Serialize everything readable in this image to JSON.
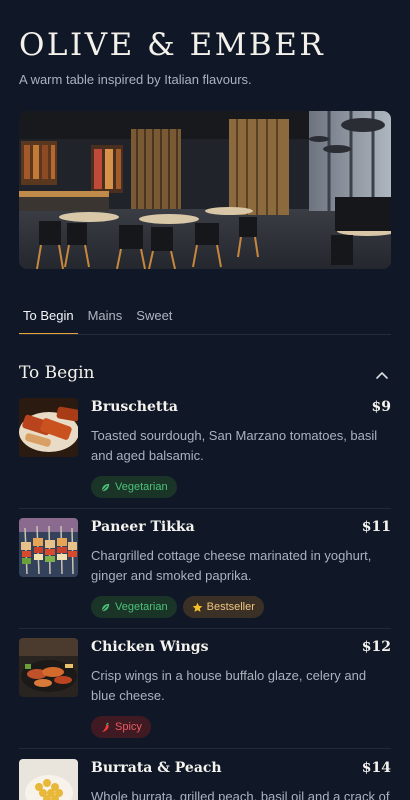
{
  "brand": {
    "name": "OLIVE & EMBER",
    "tagline": "A warm table inspired by Italian flavours."
  },
  "tabs": [
    {
      "label": "To Begin",
      "active": true
    },
    {
      "label": "Mains",
      "active": false
    },
    {
      "label": "Sweet",
      "active": false
    }
  ],
  "section": {
    "title": "To Begin",
    "toggle_icon": "chevron-up-icon"
  },
  "items": [
    {
      "name": "Bruschetta",
      "price": "$9",
      "description": "Toasted sourdough, San Marzano tomatoes, basil and aged balsamic.",
      "badges": [
        {
          "label": "Vegetarian",
          "icon": "leaf-icon",
          "kind": "veg"
        }
      ]
    },
    {
      "name": "Paneer Tikka",
      "price": "$11",
      "description": "Chargrilled cottage cheese marinated in yoghurt, ginger and smoked paprika.",
      "badges": [
        {
          "label": "Vegetarian",
          "icon": "leaf-icon",
          "kind": "veg"
        },
        {
          "label": "Bestseller",
          "icon": "star-icon",
          "kind": "best"
        }
      ]
    },
    {
      "name": "Chicken Wings",
      "price": "$12",
      "description": "Crisp wings in a house buffalo glaze, celery and blue cheese.",
      "badges": [
        {
          "label": "Spicy",
          "icon": "chili-icon",
          "kind": "spicy"
        }
      ]
    },
    {
      "name": "Burrata & Peach",
      "price": "$14",
      "description": "Whole burrata, grilled peach, basil oil and a crack of black pepper.",
      "badges": []
    }
  ],
  "colors": {
    "accent": "#e9a23b",
    "background": "#101828",
    "veg": "#4cc27a",
    "bestseller": "#f1c57f",
    "spicy": "#ee5a62"
  }
}
